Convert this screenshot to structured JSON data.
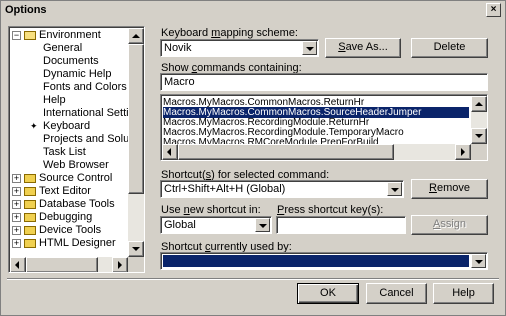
{
  "window": {
    "title": "Options",
    "close_glyph": "×"
  },
  "tree": {
    "items": [
      {
        "label": "Environment",
        "level": 0,
        "expander": "−",
        "icon": "folder-open-icon"
      },
      {
        "label": "General",
        "level": 1
      },
      {
        "label": "Documents",
        "level": 1
      },
      {
        "label": "Dynamic Help",
        "level": 1
      },
      {
        "label": "Fonts and Colors",
        "level": 1
      },
      {
        "label": "Help",
        "level": 1
      },
      {
        "label": "International Settings",
        "level": 1
      },
      {
        "label": "Keyboard",
        "level": 1,
        "selected": true,
        "icon": "pointer-arrow-icon"
      },
      {
        "label": "Projects and Solutions",
        "level": 1
      },
      {
        "label": "Task List",
        "level": 1
      },
      {
        "label": "Web Browser",
        "level": 1
      },
      {
        "label": "Source Control",
        "level": 0,
        "expander": "+",
        "icon": "folder-icon"
      },
      {
        "label": "Text Editor",
        "level": 0,
        "expander": "+",
        "icon": "folder-icon"
      },
      {
        "label": "Database Tools",
        "level": 0,
        "expander": "+",
        "icon": "folder-icon"
      },
      {
        "label": "Debugging",
        "level": 0,
        "expander": "+",
        "icon": "folder-icon"
      },
      {
        "label": "Device Tools",
        "level": 0,
        "expander": "+",
        "icon": "folder-icon"
      },
      {
        "label": "HTML Designer",
        "level": 0,
        "expander": "+",
        "icon": "folder-icon"
      }
    ]
  },
  "keyboard": {
    "mapping_label_pre": "Keyboard ",
    "mapping_label_u": "m",
    "mapping_label_post": "apping scheme:",
    "scheme_value": "Novik",
    "save_as_pre": "",
    "save_as_u": "S",
    "save_as_post": "ave As...",
    "delete_label": "Delete",
    "show_label_pre": "Show ",
    "show_label_u": "c",
    "show_label_post": "ommands containing:",
    "filter_value": "Macro",
    "commands": [
      "Macros.MyMacros.CommonMacros.ReturnHr",
      "Macros.MyMacros.CommonMacros.SourceHeaderJumper",
      "Macros.MyMacros.RecordingModule.ReturnHr",
      "Macros.MyMacros.RecordingModule.TemporaryMacro",
      "Macros.MyMacros.RMCoreModule.PrepForBuild"
    ],
    "shortcuts_label_pre": "Shortcut(",
    "shortcuts_label_u": "s",
    "shortcuts_label_post": ") for selected command:",
    "shortcut_value": "Ctrl+Shift+Alt+H (Global)",
    "remove_pre": "",
    "remove_u": "R",
    "remove_post": "emove",
    "use_in_label_pre": "Use ",
    "use_in_label_u": "n",
    "use_in_label_post": "ew shortcut in:",
    "use_in_value": "Global",
    "press_label_pre": "",
    "press_label_u": "P",
    "press_label_post": "ress shortcut key(s):",
    "press_value": "",
    "assign_pre": "",
    "assign_u": "A",
    "assign_post": "ssign",
    "currently_label_pre": "Shortcut ",
    "currently_label_u": "c",
    "currently_label_post": "urrently used by:",
    "currently_value": ""
  },
  "footer": {
    "ok": "OK",
    "cancel": "Cancel",
    "help": "Help"
  },
  "colors": {
    "selection": "#0a246a",
    "face": "#d4d0c8"
  }
}
